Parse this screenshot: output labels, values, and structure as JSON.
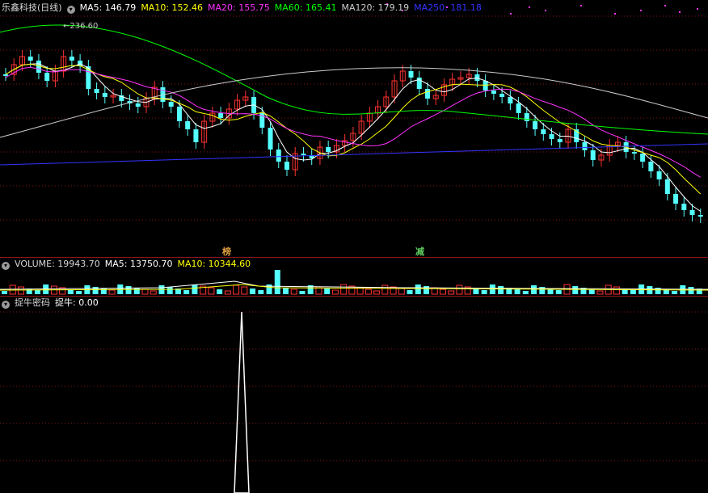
{
  "stock": {
    "name": "乐鑫科技(日线)",
    "ma": [
      {
        "label": "MA5: 146.79",
        "color": "#ffffff"
      },
      {
        "label": "MA10: 152.46",
        "color": "#ffff00"
      },
      {
        "label": "MA20: 155.75",
        "color": "#ff33ff"
      },
      {
        "label": "MA60: 165.41",
        "color": "#00ff00"
      },
      {
        "label": "MA120: 179.19",
        "color": "#cccccc"
      },
      {
        "label": "MA250: 181.18",
        "color": "#3333ff"
      }
    ],
    "high_label": "236.60",
    "badges": [
      {
        "text": "榜",
        "color": "#e0a040"
      },
      {
        "text": "减",
        "color": "#60d060"
      }
    ]
  },
  "volume": {
    "title": "VOLUME: 19943.70",
    "ma5": "MA5: 13750.70",
    "ma10": "MA10: 10344.60"
  },
  "indicator": {
    "name": "捉牛密码",
    "value": "捉牛: 0.00"
  },
  "colors": {
    "up": "#ff3232",
    "down": "#54ffff",
    "grid": "#8a1616",
    "background": "#000000"
  }
}
